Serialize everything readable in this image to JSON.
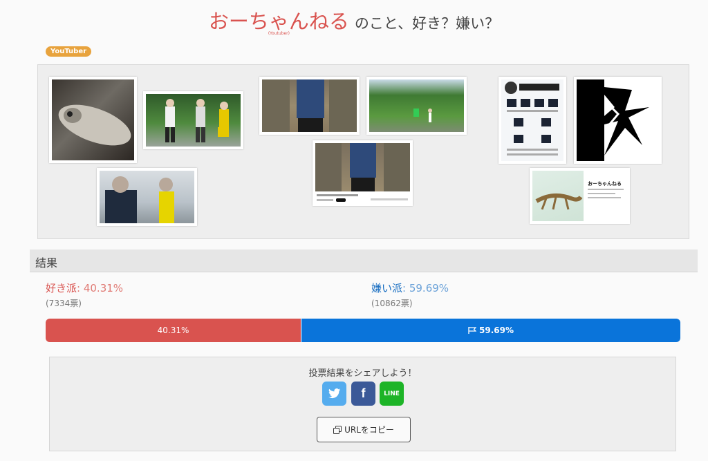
{
  "header": {
    "title": "おーちゃんねる",
    "title_ruby": "(Youtuber)",
    "question": "のこと、好き？嫌い？"
  },
  "category_badge": "YouTuber",
  "gallery": {
    "thumbs": [
      {
        "name": "fish-photo"
      },
      {
        "name": "group-with-nets"
      },
      {
        "name": "police-officer"
      },
      {
        "name": "crossed-arms-road"
      },
      {
        "name": "crossed-arms-video"
      },
      {
        "name": "field-jump"
      },
      {
        "name": "merch-poster"
      },
      {
        "name": "calligraphy-logo"
      },
      {
        "name": "lizard-profile-card"
      }
    ],
    "video_caption": "おーちゃんねる"
  },
  "results": {
    "header": "結果",
    "like": {
      "label": "好き派",
      "percent": "40.31%",
      "votes": "(7334票)"
    },
    "dislike": {
      "label": "嫌い派",
      "percent": "59.69%",
      "votes": "(10862票)"
    },
    "bar": {
      "like_text": "40.31%",
      "dislike_text": "59.69%",
      "like_fraction": 0.4031
    }
  },
  "share": {
    "title": "投票結果をシェアしよう！",
    "twitter_icon": "twitter-icon",
    "facebook_label": "f",
    "line_label": "LINE",
    "copy_label": "URLをコピー"
  },
  "colors": {
    "like": "#d9534f",
    "dislike": "#0a74da",
    "badge": "#e8a33d"
  }
}
